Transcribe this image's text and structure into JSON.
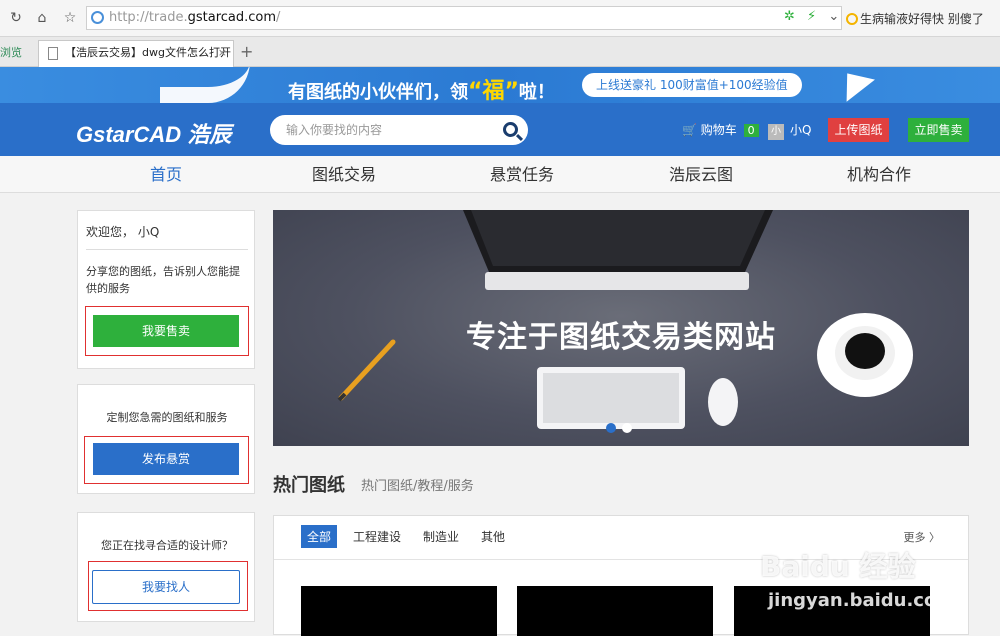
{
  "browser": {
    "url_prefix": "http://trade.",
    "url_host": "gstarcad.com",
    "url_suffix": "/",
    "news_ticker": "生病输液好得快 别傻了",
    "side_tab_label": "浏览",
    "tab_title": "【浩辰云交易】dwg文件怎么打开",
    "tab_close": "×",
    "new_tab": "+"
  },
  "promo": {
    "text_before": "有图纸的小伙伴们，领",
    "highlight": "“福”",
    "text_after": "啦！",
    "pill": "上线送豪礼   100财富值+100经验值"
  },
  "header": {
    "logo": "GstarCAD 浩辰",
    "search_placeholder": "输入你要找的内容",
    "cart_label": "购物车",
    "cart_count": "0",
    "avatar_text": "小",
    "user_name": "小Q",
    "upload_button": "上传图纸",
    "sell_button": "立即售卖"
  },
  "nav": {
    "items": [
      "首页",
      "图纸交易",
      "悬赏任务",
      "浩辰云图",
      "机构合作"
    ],
    "active_index": 0
  },
  "sidebar": {
    "welcome": "欢迎您， 小Q",
    "share_text": "分享您的图纸，告诉别人您能提供的服务",
    "sell_button": "我要售卖",
    "custom_text": "定制您急需的图纸和服务",
    "bounty_button": "发布悬赏",
    "designer_text": "您正在找寻合适的设计师？",
    "find_button": "我要找人"
  },
  "hero": {
    "title": "专注于图纸交易类网站"
  },
  "hot": {
    "title": "热门图纸",
    "subtitle": "热门图纸/教程/服务",
    "tabs": [
      "全部",
      "工程建设",
      "制造业",
      "其他"
    ],
    "active_tab": 0,
    "more": "更多 〉"
  },
  "watermark": {
    "text": "Baidu 经验",
    "url": "jingyan.baidu.com"
  },
  "colors": {
    "brand_blue": "#2a6fc9",
    "green": "#2eb03c",
    "red": "#e04040",
    "highlight_gold": "#ffd700"
  }
}
